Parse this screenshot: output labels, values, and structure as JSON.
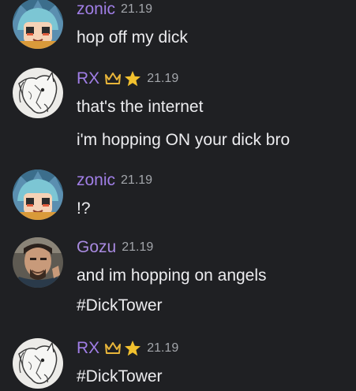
{
  "colors": {
    "background": "#1f2023",
    "zonic_name": "#a07ee6",
    "rx_name": "#a07ee6",
    "gozu_name": "#a88ae0",
    "crown": "#e8b53a",
    "star": "#f2c12e",
    "timestamp": "#a3a6ab"
  },
  "messages": [
    {
      "author": "zonic",
      "timestamp": "21.19",
      "badges": [],
      "avatar": "anime-character-avatar",
      "lines": [
        "hop off my dick"
      ]
    },
    {
      "author": "RX",
      "timestamp": "21.19",
      "badges": [
        "crown-icon",
        "star-icon"
      ],
      "avatar": "horse-sketch-avatar",
      "lines": [
        "that's the internet",
        "i'm hopping ON your dick bro"
      ]
    },
    {
      "author": "zonic",
      "timestamp": "21.19",
      "badges": [],
      "avatar": "anime-character-avatar",
      "lines": [
        "!?"
      ]
    },
    {
      "author": "Gozu",
      "timestamp": "21.19",
      "badges": [],
      "avatar": "man-photo-avatar",
      "lines": [
        "and im hopping on angels",
        "#DickTower"
      ]
    },
    {
      "author": "RX",
      "timestamp": "21.19",
      "badges": [
        "crown-icon",
        "star-icon"
      ],
      "avatar": "horse-sketch-avatar",
      "lines": [
        "#DickTower"
      ]
    }
  ]
}
